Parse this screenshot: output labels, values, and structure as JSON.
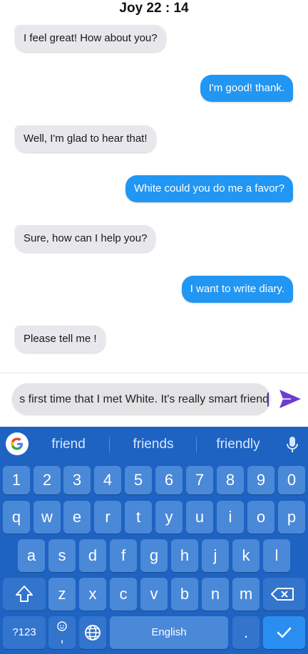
{
  "header": {
    "title": "Joy 22 : 14"
  },
  "messages": [
    {
      "side": "in",
      "text": "I feel great! How about you?"
    },
    {
      "side": "out",
      "text": "I'm good! thank."
    },
    {
      "side": "in",
      "text": "Well, I'm glad to hear that!"
    },
    {
      "side": "out",
      "text": "White could you do me a favor?"
    },
    {
      "side": "in",
      "text": "Sure, how can I help you?"
    },
    {
      "side": "out",
      "text": "I want to write diary."
    },
    {
      "side": "in",
      "text": "Please tell me !"
    }
  ],
  "composer": {
    "input_value": "s first time that I met White. It's really smart friend",
    "send_icon": "send-icon"
  },
  "colors": {
    "incoming_bubble": "#e8e8ec",
    "outgoing_bubble": "#2196f3",
    "keyboard_bg": "#1e63c2",
    "key_bg": "#4a88d8",
    "send_icon": "#6a3fcf"
  },
  "keyboard": {
    "suggestions": [
      "friend",
      "friends",
      "friendly"
    ],
    "google_icon": "google-icon",
    "mic_icon": "mic-icon",
    "row_numbers": [
      "1",
      "2",
      "3",
      "4",
      "5",
      "6",
      "7",
      "8",
      "9",
      "0"
    ],
    "row_top": [
      "q",
      "w",
      "e",
      "r",
      "t",
      "y",
      "u",
      "i",
      "o",
      "p"
    ],
    "row_middle": [
      "a",
      "s",
      "d",
      "f",
      "g",
      "h",
      "j",
      "k",
      "l"
    ],
    "row_bottom": [
      "z",
      "x",
      "c",
      "v",
      "b",
      "n",
      "m"
    ],
    "shift_icon": "shift-icon",
    "backspace_icon": "backspace-icon",
    "symbols_label": "?123",
    "emoji_icon": "emoji-icon",
    "comma_label": ",",
    "globe_icon": "globe-icon",
    "space_label": "English",
    "period_label": ".",
    "enter_icon": "checkmark-icon"
  }
}
